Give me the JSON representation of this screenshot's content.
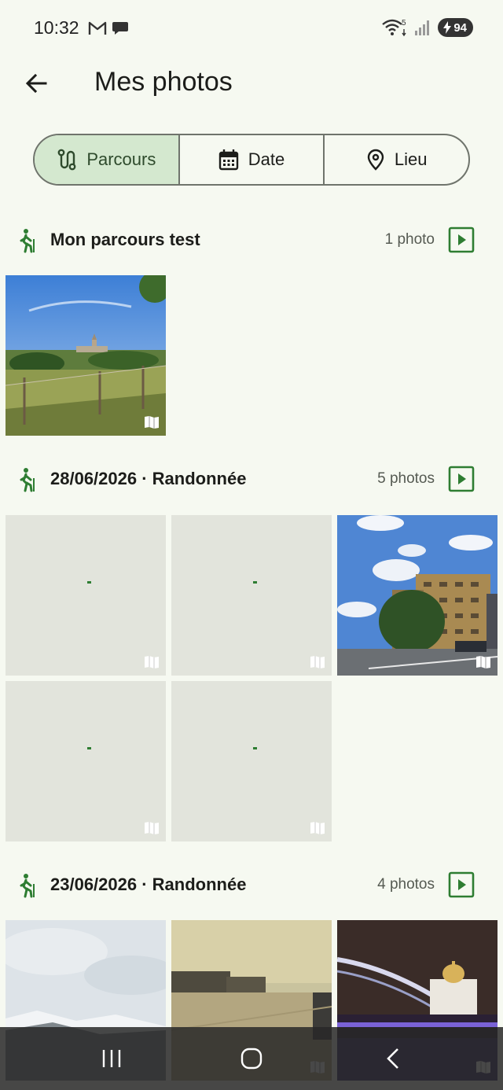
{
  "status_bar": {
    "time": "10:32",
    "battery": "94",
    "signal_label": "5"
  },
  "app_bar": {
    "title": "Mes photos",
    "back_icon": "arrow-left-icon"
  },
  "segments": [
    {
      "label": "Parcours",
      "icon": "route-icon",
      "selected": true
    },
    {
      "label": "Date",
      "icon": "calendar-icon",
      "selected": false
    },
    {
      "label": "Lieu",
      "icon": "location-pin-icon",
      "selected": false
    }
  ],
  "sections": [
    {
      "title": "Mon parcours test",
      "count": "1 photo"
    },
    {
      "title": "28/06/2026 · Randonnée",
      "count": "5 photos"
    },
    {
      "title": "23/06/2026 · Randonnée",
      "count": "4 photos"
    }
  ],
  "colors": {
    "background": "#f6f9f1",
    "accent_green": "#2e7d32",
    "selected_segment": "#d4e8cf",
    "placeholder": "#e2e4dc"
  }
}
